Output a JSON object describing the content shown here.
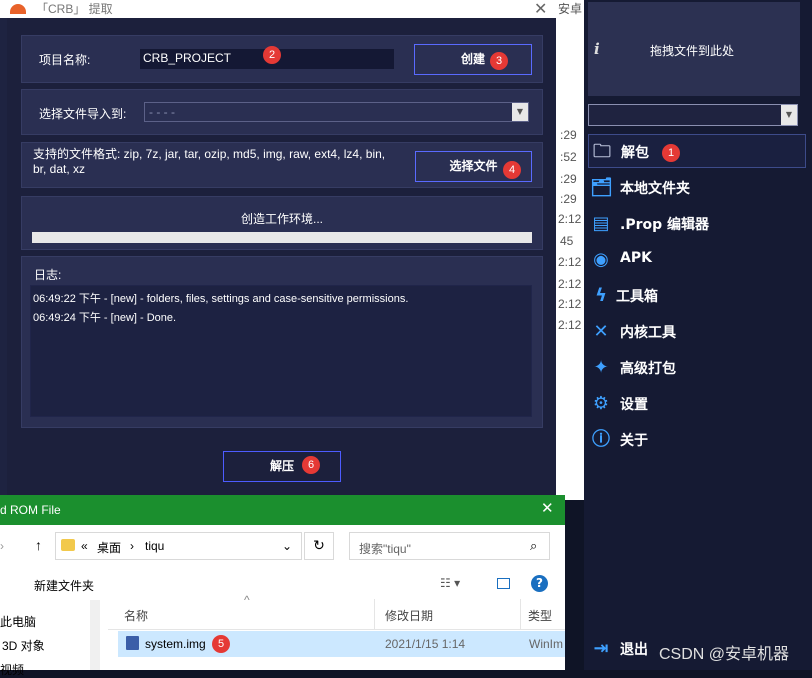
{
  "dialog": {
    "title": "「CRB」 提取",
    "close_glyph": "✕",
    "project_label": "项目名称:",
    "project_value": "CRB_PROJECT",
    "create_button": "创建",
    "import_label": "选择文件导入到:",
    "import_value": "- - - -",
    "formats_text": "支持的文件格式: zip, 7z, jar, tar, ozip, md5, img, raw, ext4, lz4, bin, br, dat, xz",
    "select_file_button": "选择文件",
    "status_text": "创造工作环境...",
    "progress": 0,
    "log_label": "日志:",
    "log_lines": [
      "06:49:22 下午 - [new] - folders, files, settings and case-sensitive permissions.",
      "06:49:24 下午 - [new] - Done."
    ],
    "extract_button": "解压"
  },
  "badges": [
    "1",
    "2",
    "3",
    "4",
    "5",
    "6"
  ],
  "background_strip": [
    ":29",
    ":52",
    ":29",
    ":29",
    "2:12",
    "45",
    "2:12",
    "2:12",
    "2:12",
    "2:12",
    "安卓"
  ],
  "sidebar": {
    "info_icon": "i",
    "drop_text": "拖拽文件到此处",
    "items": [
      {
        "icon": "folder-icon",
        "label": "解包"
      },
      {
        "icon": "folders-icon",
        "label": "本地文件夹"
      },
      {
        "icon": "document-icon",
        "label": ".Prop 编辑器"
      },
      {
        "icon": "android-icon",
        "label": "APK"
      },
      {
        "icon": "lightning-icon",
        "label": "工具箱"
      },
      {
        "icon": "tools-icon",
        "label": "内核工具"
      },
      {
        "icon": "sparkle-icon",
        "label": "高级打包"
      },
      {
        "icon": "gear-icon",
        "label": "设置"
      },
      {
        "icon": "info-icon",
        "label": "关于"
      }
    ],
    "exit_label": "退出",
    "watermark": "CSDN @安卓机器"
  },
  "explorer": {
    "title": "d ROM File",
    "close_glyph": "✕",
    "path_prefix": "«",
    "path_desktop": "桌面",
    "path_sep": "›",
    "path_folder": "tiqu",
    "search_placeholder": "搜索\"tiqu\"",
    "new_folder": "新建文件夹",
    "col_name": "名称",
    "col_date": "修改日期",
    "col_type": "类型",
    "nav_items": [
      "此电脑",
      "3D 对象",
      "视频"
    ],
    "file": {
      "name": "system.img",
      "date": "2021/1/15 1:14",
      "type": "WinIm"
    }
  }
}
